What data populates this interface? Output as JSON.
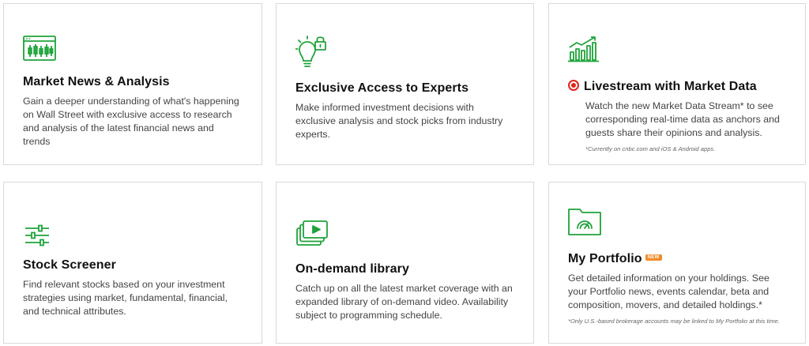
{
  "accent_color": "#1fa33a",
  "live_color": "#e2231a",
  "badge_color": "#f28c28",
  "cards": [
    {
      "icon": "candlestick-chart-icon",
      "title": "Market News & Analysis",
      "description": "Gain a deeper understanding of what's happening on Wall Street with exclusive access to research and analysis of the latest financial news and trends"
    },
    {
      "icon": "lightbulb-lock-icon",
      "title": "Exclusive Access to Experts",
      "description": "Make informed investment decisions with exclusive analysis and stock picks from industry experts."
    },
    {
      "icon": "rising-bar-chart-icon",
      "title": "Livestream with Market Data",
      "description": "Watch the new Market Data Stream* to see corresponding real-time data as anchors and guests share their opinions and analysis.",
      "note": "*Currently on cnbc.com and iOS & Android apps."
    },
    {
      "icon": "sliders-icon",
      "title": "Stock Screener",
      "description": "Find relevant stocks based on your investment strategies using market, fundamental, financial, and technical attributes."
    },
    {
      "icon": "video-library-icon",
      "title": "On-demand library",
      "description": "Catch up on all the latest market coverage with an expanded library of on-demand video. Availability subject to programming schedule."
    },
    {
      "icon": "portfolio-folder-gauge-icon",
      "title": "My Portfolio",
      "badge": "NEW",
      "description": "Get detailed information on your holdings. See your Portfolio news, events calendar, beta and composition, movers, and detailed holdings.*",
      "note": "*Only U.S.-based brokerage accounts may be linked to My Portfolio at this time."
    }
  ]
}
